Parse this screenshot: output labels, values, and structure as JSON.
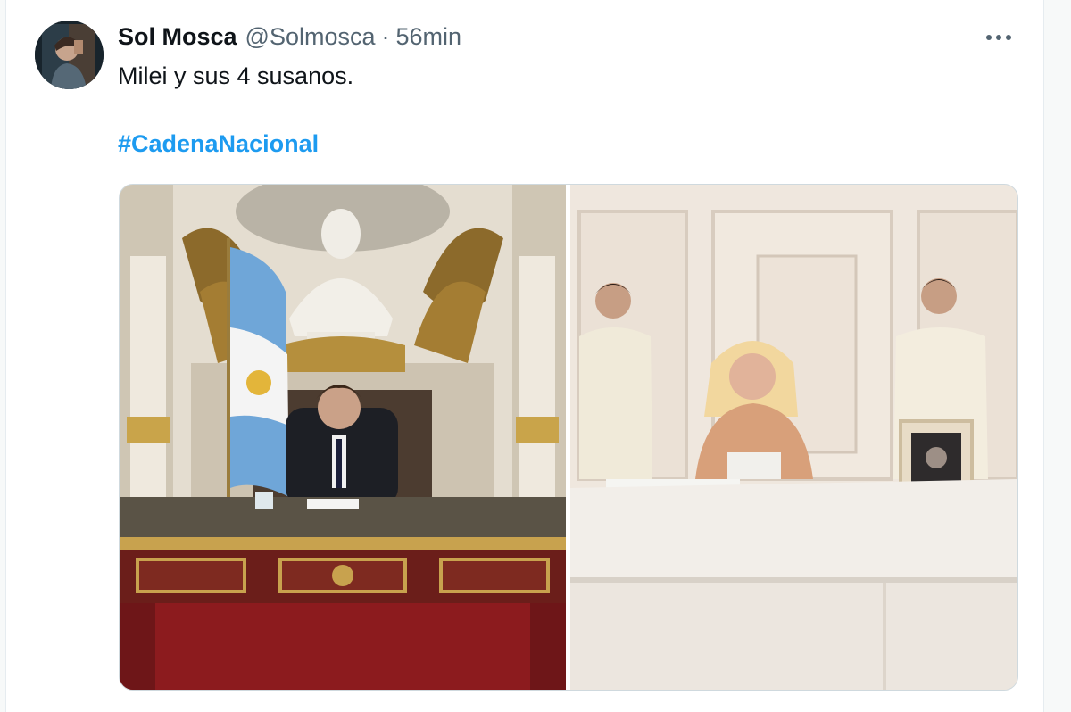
{
  "tweet": {
    "display_name": "Sol Mosca",
    "handle": "@Solmosca",
    "separator": "·",
    "time": "56min",
    "text": "Milei y sus 4 susanos.",
    "hashtag": "#CadenaNacional",
    "more_icon": "more-horizontal-icon"
  },
  "media": {
    "images": [
      {
        "name": "photo-left"
      },
      {
        "name": "photo-right"
      }
    ]
  },
  "colors": {
    "link": "#1d9bf0",
    "secondary_text": "#536471",
    "primary_text": "#0f1419"
  }
}
